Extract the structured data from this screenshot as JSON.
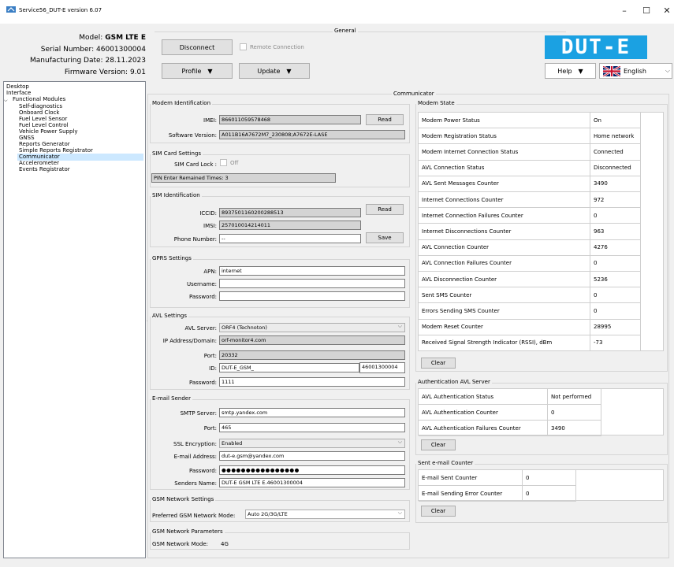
{
  "window": {
    "title": "Service56_DUT-E version 6.07"
  },
  "device": {
    "model_label": "Model:",
    "model": "GSM LTE E",
    "serial_label": "Serial Number:",
    "serial": "46001300004",
    "mfg_label": "Manufacturing Date:",
    "mfg": "28.11.2023",
    "fw_label": "Firmware Version:",
    "fw": "9.01"
  },
  "general": {
    "title": "General",
    "disconnect": "Disconnect",
    "remote": "Remote Connection",
    "profile": "Profile",
    "update": "Update",
    "help": "Help",
    "logo": "DUT-E",
    "language": "English"
  },
  "tree": {
    "items": [
      "Desktop",
      "Interface",
      "Functional Modules",
      "Self-diagnostics",
      "Onboard Clock",
      "Fuel Level Sensor",
      "Fuel Level Control",
      "Vehicle Power Supply",
      "GNSS",
      "Reports Generator",
      "Simple Reports Registrator",
      "Communicator",
      "Accelerometer",
      "Events Registrator"
    ],
    "selected": "Communicator"
  },
  "communicator": {
    "title": "Communicator",
    "modem_id": {
      "title": "Modem Identification",
      "imei_label": "IMEI:",
      "imei": "866011059578468",
      "read": "Read",
      "sw_label": "Software Version:",
      "sw": "A011B16A7672M7_230808;A7672E-LASE"
    },
    "sim_card": {
      "title": "SIM Card Settings",
      "lock_label": "SIM Card Lock :",
      "lock_value": "Off",
      "pin_text": "PIN Enter Remained Times: 3"
    },
    "sim_id": {
      "title": "SIM Identification",
      "iccid_label": "ICCID:",
      "iccid": "8937501160200288513",
      "read": "Read",
      "imsi_label": "IMSI:",
      "imsi": "257010014214011",
      "phone_label": "Phone Number:",
      "phone": "--",
      "save": "Save"
    },
    "gprs": {
      "title": "GPRS Settings",
      "apn_label": "APN:",
      "apn": "internet",
      "user_label": "Username:",
      "user": "",
      "pass_label": "Password:",
      "pass": ""
    },
    "avl": {
      "title": "AVL Settings",
      "server_label": "AVL Server:",
      "server": "ORF4 (Technoton)",
      "ip_label": "IP Address/Domain:",
      "ip": "orf-monitor4.com",
      "port_label": "Port:",
      "port": "20332",
      "id_label": "ID:",
      "id": "DUT-E_GSM_",
      "id_suffix": "46001300004",
      "pass_label": "Password:",
      "pass": "1111"
    },
    "email": {
      "title": "E-mail Sender",
      "smtp_label": "SMTP Server:",
      "smtp": "smtp.yandex.com",
      "port_label": "Port:",
      "port": "465",
      "ssl_label": "SSL Encryption:",
      "ssl": "Enabled",
      "addr_label": "E-mail Address:",
      "addr": "dut-e.gsm@yandex.com",
      "pass_label": "Password:",
      "pass": "●●●●●●●●●●●●●●●●",
      "sender_label": "Senders Name:",
      "sender": "DUT-E GSM LTE E.46001300004"
    },
    "gsm_settings": {
      "title": "GSM Network Settings",
      "mode_label": "Preferred GSM Network Mode:",
      "mode": "Auto 2G/3G/LTE"
    },
    "gsm_params": {
      "title": "GSM Network Parameters",
      "mode_label": "GSM Network Mode:",
      "mode": "4G"
    }
  },
  "modem_state": {
    "title": "Modem State",
    "rows": [
      {
        "label": "Modem Power Status",
        "value": "On"
      },
      {
        "label": "Modem Registration Status",
        "value": "Home network"
      },
      {
        "label": "Modem Internet Connection Status",
        "value": "Connected"
      },
      {
        "label": "AVL Connection Status",
        "value": "Disconnected"
      },
      {
        "label": "AVL Sent Messages Counter",
        "value": "3490"
      },
      {
        "label": "Internet Connections Counter",
        "value": "972"
      },
      {
        "label": "Internet Connection Failures Counter",
        "value": "0"
      },
      {
        "label": "Internet Disconnections Counter",
        "value": "963"
      },
      {
        "label": "AVL Connection Counter",
        "value": "4276"
      },
      {
        "label": "AVL Connection Failures Counter",
        "value": "0"
      },
      {
        "label": "AVL Disconnection Counter",
        "value": "5236"
      },
      {
        "label": "Sent SMS Counter",
        "value": "0"
      },
      {
        "label": "Errors Sending SMS Counter",
        "value": "0"
      },
      {
        "label": "Modem Reset Counter",
        "value": "28995"
      },
      {
        "label": "Received Signal Strength Indicator (RSSI), dBm",
        "value": "-73"
      }
    ],
    "clear": "Clear"
  },
  "auth": {
    "title": "Authentication AVL Server",
    "rows": [
      {
        "label": "AVL Authentication Status",
        "value": "Not performed"
      },
      {
        "label": "AVL Authentication Counter",
        "value": "0"
      },
      {
        "label": "AVL Authentication Failures Counter",
        "value": "3490"
      }
    ],
    "clear": "Clear"
  },
  "sent_email": {
    "title": "Sent e-mail Counter",
    "rows": [
      {
        "label": "E-mail Sent Counter",
        "value": "0"
      },
      {
        "label": "E-mail Sending Error Counter",
        "value": "0"
      }
    ],
    "clear": "Clear"
  },
  "colors": {
    "logo_bg": "#1ba1e2",
    "selected_bg": "#cce8ff"
  }
}
